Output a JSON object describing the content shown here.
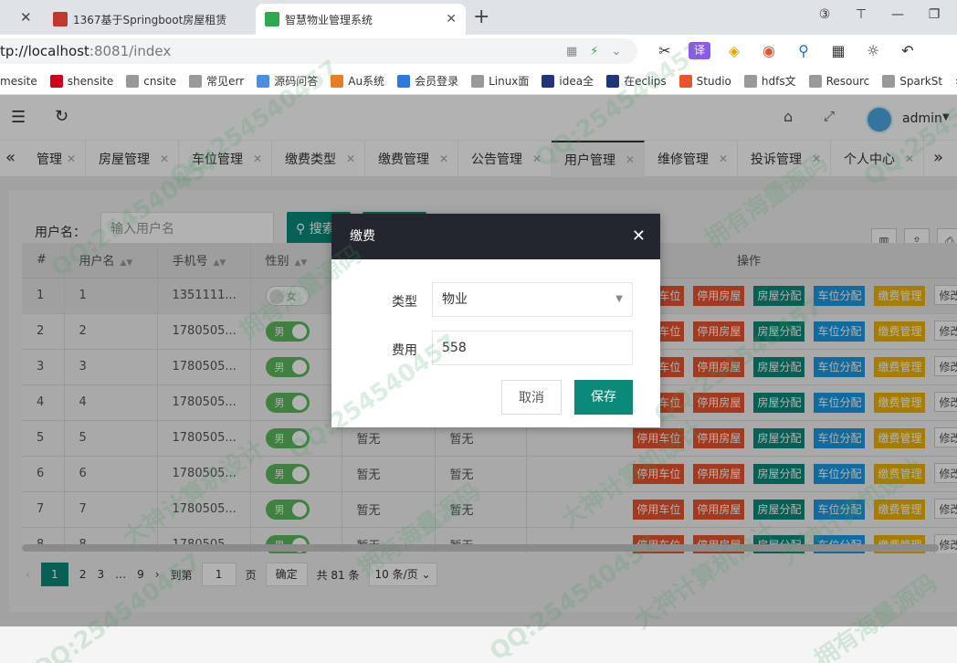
{
  "browser": {
    "tabs": [
      {
        "title": "1367基于Springboot房屋租赁",
        "active": false
      },
      {
        "title": "智慧物业管理系统",
        "active": true
      }
    ],
    "url_host": "tp://localhost",
    "url_path": ":8081/index",
    "ext_icon_label": "译",
    "bookmarks": [
      "mesite",
      "shensite",
      "cnsite",
      "常见err",
      "源码问答",
      "Au系统",
      "会员登录",
      "Linux面",
      "idea全",
      "在eclips",
      "Studio",
      "hdfs文",
      "Resourc",
      "SparkSt"
    ],
    "bookmarks_more": "»"
  },
  "app": {
    "user_name": "admin",
    "tabs": [
      "管理",
      "房屋管理",
      "车位管理",
      "缴费类型",
      "缴费管理",
      "公告管理",
      "用户管理",
      "维修管理",
      "投诉管理",
      "个人中心"
    ],
    "active_tab": "用户管理",
    "search": {
      "label": "用户名：",
      "placeholder": "输入用户名",
      "button": "搜索"
    },
    "table": {
      "headers": [
        "#",
        "用户名",
        "手机号",
        "性别",
        "",
        "",
        "操作"
      ],
      "rows": [
        {
          "num": "1",
          "username": "1",
          "phone": "1351111...",
          "gender": "女",
          "gender_on": false,
          "c4": "",
          "c5": ""
        },
        {
          "num": "2",
          "username": "2",
          "phone": "1780505...",
          "gender": "男",
          "gender_on": true,
          "c4": "",
          "c5": ""
        },
        {
          "num": "3",
          "username": "3",
          "phone": "1780505...",
          "gender": "男",
          "gender_on": true,
          "c4": "",
          "c5": ""
        },
        {
          "num": "4",
          "username": "4",
          "phone": "1780505...",
          "gender": "男",
          "gender_on": true,
          "c4": "",
          "c5": ""
        },
        {
          "num": "5",
          "username": "5",
          "phone": "1780505...",
          "gender": "男",
          "gender_on": true,
          "c4": "暂无",
          "c5": "暂无"
        },
        {
          "num": "6",
          "username": "6",
          "phone": "1780505...",
          "gender": "男",
          "gender_on": true,
          "c4": "暂无",
          "c5": "暂无"
        },
        {
          "num": "7",
          "username": "7",
          "phone": "1780505...",
          "gender": "男",
          "gender_on": true,
          "c4": "暂无",
          "c5": "暂无"
        },
        {
          "num": "8",
          "username": "8",
          "phone": "1780505...",
          "gender": "男",
          "gender_on": true,
          "c4": "暂无",
          "c5": "暂无"
        }
      ],
      "action_labels": {
        "stop_parking": "停用车位",
        "stop_house": "停用房屋",
        "assign_house": "房屋分配",
        "assign_parking": "车位分配",
        "fee_manage": "缴费管理",
        "edit": "修改"
      }
    },
    "pagination": {
      "pages": [
        "1",
        "2",
        "3",
        "…",
        "9"
      ],
      "current": "1",
      "goto_label": "到第",
      "goto_value": "1",
      "page_unit": "页",
      "confirm": "确定",
      "total": "共 81 条",
      "page_size": "10 条/页"
    }
  },
  "modal": {
    "title": "缴费",
    "type_label": "类型",
    "type_value": "物业",
    "fee_label": "费用",
    "fee_value": "558",
    "cancel": "取消",
    "save": "保存"
  },
  "watermark": {
    "texts": [
      "QQ:254540457",
      "拥有海量源码",
      "大神计算机设计"
    ]
  },
  "colors": {
    "primary": "#0b8a7a",
    "red": "#e9542f",
    "blue": "#1a9ae3",
    "yellow": "#f0b400",
    "switch_on": "#5cb85c",
    "modal_header": "#23262e"
  }
}
